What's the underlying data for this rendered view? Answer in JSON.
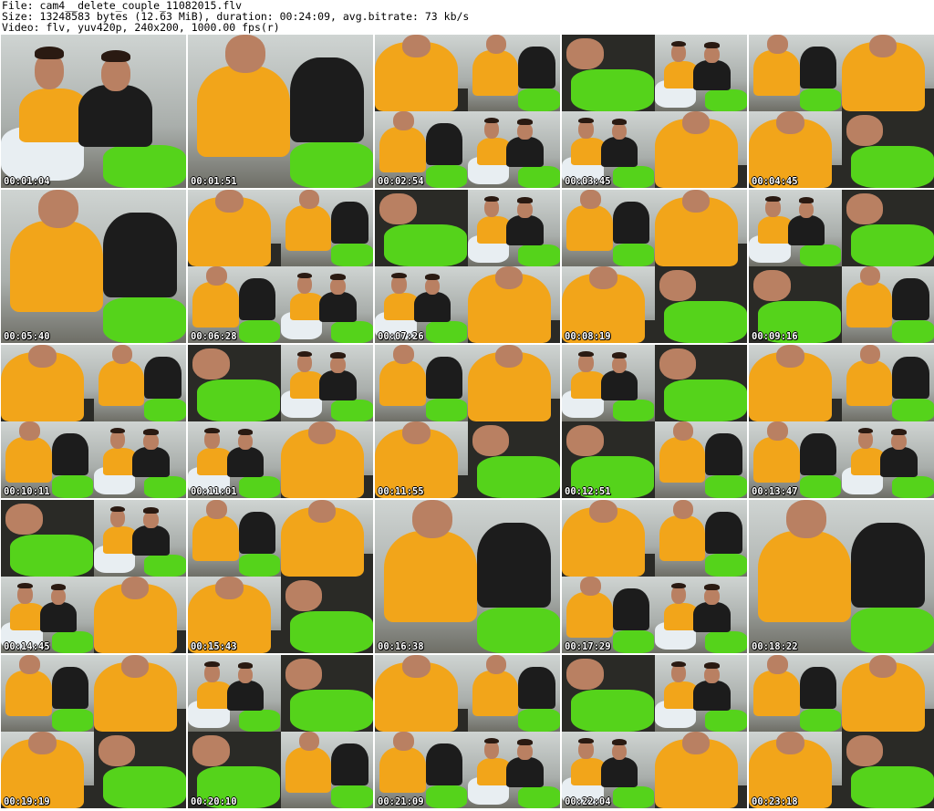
{
  "header": {
    "line1": "File: cam4__delete_couple_11082015.flv",
    "line2": "Size: 13248583 bytes (12.63 MiB), duration: 00:24:09, avg.bitrate: 73 kb/s",
    "line3": "Video: flv, yuv420p, 240x200, 1000.00 fps(r)"
  },
  "thumbnails": [
    {
      "time": "00:01:04",
      "layout": "full"
    },
    {
      "time": "00:01:51",
      "layout": "full"
    },
    {
      "time": "00:02:54",
      "layout": "quad"
    },
    {
      "time": "00:03:45",
      "layout": "quad"
    },
    {
      "time": "00:04:45",
      "layout": "quad"
    },
    {
      "time": "00:05:40",
      "layout": "full"
    },
    {
      "time": "00:06:28",
      "layout": "quad"
    },
    {
      "time": "00:07:26",
      "layout": "quad"
    },
    {
      "time": "00:08:19",
      "layout": "quad"
    },
    {
      "time": "00:09:16",
      "layout": "quad"
    },
    {
      "time": "00:10:11",
      "layout": "quad"
    },
    {
      "time": "00:11:01",
      "layout": "quad"
    },
    {
      "time": "00:11:55",
      "layout": "quad"
    },
    {
      "time": "00:12:51",
      "layout": "quad"
    },
    {
      "time": "00:13:47",
      "layout": "quad"
    },
    {
      "time": "00:14:45",
      "layout": "quad"
    },
    {
      "time": "00:15:43",
      "layout": "quad"
    },
    {
      "time": "00:16:38",
      "layout": "full"
    },
    {
      "time": "00:17:29",
      "layout": "quad"
    },
    {
      "time": "00:18:22",
      "layout": "full"
    },
    {
      "time": "00:19:19",
      "layout": "quad"
    },
    {
      "time": "00:20:10",
      "layout": "quad"
    },
    {
      "time": "00:21:09",
      "layout": "quad"
    },
    {
      "time": "00:22:04",
      "layout": "quad"
    },
    {
      "time": "00:23:18",
      "layout": "quad"
    }
  ]
}
